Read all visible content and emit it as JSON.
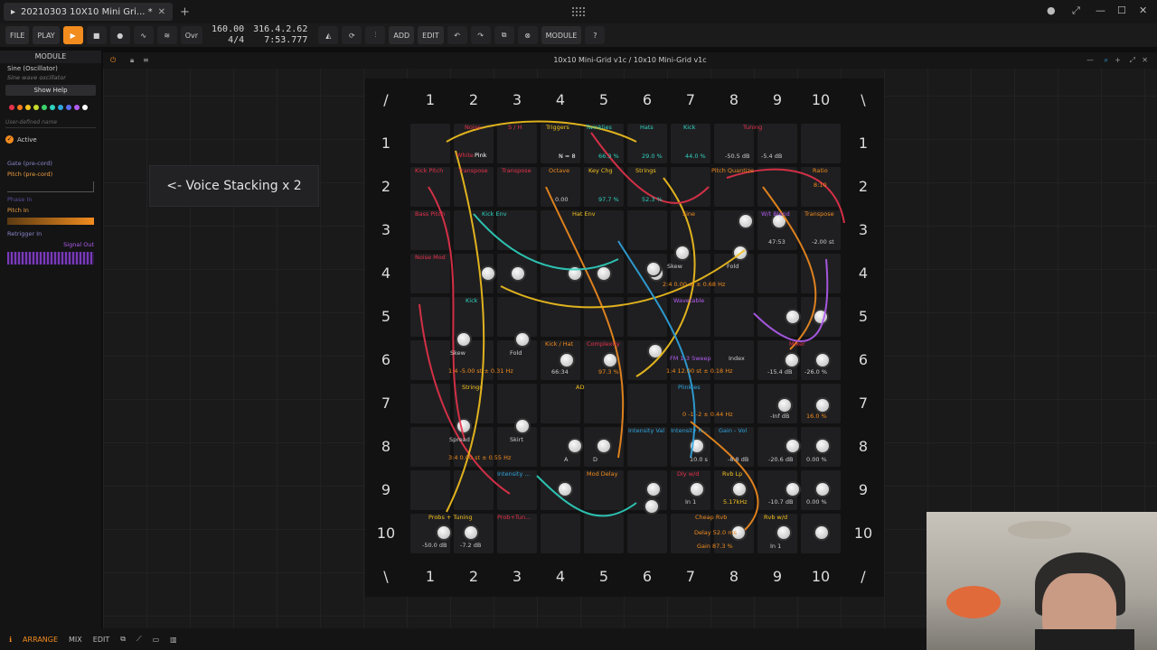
{
  "window": {
    "tab_title": "20210303 10X10 Mini Gri... *",
    "minimize": "—",
    "maximize": "☐",
    "close": "✕"
  },
  "toolbar": {
    "file": "FILE",
    "play": "PLAY",
    "tempo": "160.00",
    "meter": "4/4",
    "position": "316.4.2.62",
    "time": "7:53.777",
    "add": "ADD",
    "edit": "EDIT",
    "module": "MODULE",
    "ovr": "Ovr"
  },
  "inspector": {
    "header": "MODULE",
    "device_name": "Sine (Oscillator)",
    "device_sub": "Sine wave oscillator",
    "show_help": "Show Help",
    "user_name_placeholder": "User-defined name",
    "active": "Active",
    "io": [
      "Gate (pre-cord)",
      "Pitch (pre-cord)",
      "Phase In",
      "Pitch In",
      "Retrigger In",
      "Signal Out"
    ],
    "colors": [
      "#e6324b",
      "#f07a1e",
      "#f5c31e",
      "#c7dc2a",
      "#3cd36b",
      "#2fd3c1",
      "#2fa6e0",
      "#5b6ef0",
      "#b25cf0",
      "#ffffff"
    ]
  },
  "main": {
    "title": "10x10 Mini-Grid v1c / 10x10 Mini-Grid v1c",
    "voice_stacking": "<- Voice Stacking x 2"
  },
  "grid": {
    "corner_tl": "/",
    "corner_tr": "\\",
    "corner_bl": "\\",
    "corner_br": "/",
    "cols": [
      "1",
      "2",
      "3",
      "4",
      "5",
      "6",
      "7",
      "8",
      "9",
      "10"
    ],
    "rows": [
      "1",
      "2",
      "3",
      "4",
      "5",
      "6",
      "7",
      "8",
      "9",
      "10"
    ]
  },
  "modules": {
    "noise": "Noise",
    "sh": "S / H",
    "triggers": "Triggers",
    "twinklies": "Twinklies",
    "hats": "Hats",
    "kick": "Kick",
    "tuning": "Tuning",
    "kick_pitch": "Kick Pitch",
    "transpose": "Transpose",
    "transpose2": "Transpose",
    "octave": "Octave",
    "key_chg": "Key Chg",
    "strings": "Strings",
    "pitch_quantize": "Pitch Quantize",
    "ratio": "Ratio",
    "bass_pitch": "Bass Pitch",
    "kick_env": "Kick Env",
    "hat_env": "Hat Env",
    "sine": "Sine",
    "wt_blend": "W/t Blend",
    "transpose3": "Transpose",
    "noise_mod": "Noise Mod",
    "kick2": "Kick",
    "wavetable": "Wavetable",
    "kick_hat": "Kick / Hat",
    "complexity": "Complexity",
    "strings2": "Strings",
    "ad": "AD",
    "plinkies": "Plinkies",
    "mixer": "Mixer",
    "intensity_val": "Intensity Val",
    "intensity_r": "Intensity R...",
    "gain_vol": "Gain - Vol",
    "intensity": "Intensity ...",
    "mod_delay": "Mod Delay",
    "dly_wd": "Dly w/d",
    "rvb_lp": "Rvb Lp",
    "probs_tuning": "Probs + Tuning",
    "prob_tune": "Prob+Tun...",
    "cheap_rvb": "Cheap Rvb",
    "rvb_wd": "Rvb w/d",
    "white": "White",
    "pink": "Pink",
    "n8": "N = 8",
    "v663": "66.3 %",
    "v290": "29.0 %",
    "v440": "44.0 %",
    "v505": "-50.5 dB",
    "v54": "-5.4 dB",
    "v000": "0.00",
    "v977": "97.7 %",
    "v523": "52.3 %",
    "v810": "8:10",
    "v4753": "47:53",
    "v200": "-2.00 st",
    "skew": "Skew",
    "fold": "Fold",
    "sine_params": "2:4    0.00 st   ± 0.68 Hz",
    "kick_params": "1:4   -5.00 st   ± 0.31 Hz",
    "v6634": "66:34",
    "v973": "97.3 %",
    "fm": "FM 1-3 Sweep",
    "index": "Index",
    "wt_params": "1:4   12.00 st   ± 0.18 Hz",
    "v154": "-15.4 dB",
    "v260": "-26.0 %",
    "spread": "Spread",
    "skirt": "Skirt",
    "str_params": "3:4    0.00 st   ± 0.55 Hz",
    "a": "A",
    "d": "D",
    "s": "S",
    "pl_params": "0   -1   -2   ± 0.44 Hz",
    "vinf": "-Inf dB",
    "v160": "16.0 %",
    "v100": "10.0 s",
    "v88": "-8.8 dB",
    "v206": "-20.6 dB",
    "v000b": "0.00 %",
    "v517": "5.17kHz",
    "v107": "-10.7 dB",
    "v000c": "0.00 %",
    "in1": "In 1",
    "v500": "-50.0 dB",
    "v72": "-7.2 dB",
    "delay": "Delay  52.0 ms",
    "gain": "Gain  87.3 %",
    "in1b": "In 1"
  },
  "bottom": {
    "arrange": "ARRANGE",
    "mix": "MIX",
    "edit": "EDIT"
  }
}
